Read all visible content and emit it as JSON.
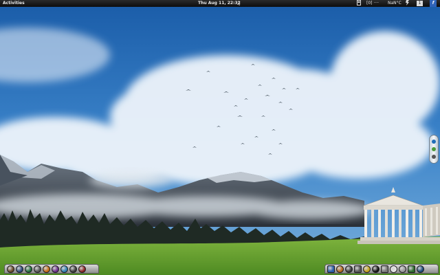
{
  "top_panel": {
    "activities_label": "Activities",
    "clock": "Thu Aug 11, 22:32",
    "music_icon": "♫",
    "network_text": "[0] ····",
    "weather_text": "NaN°C",
    "workspace_number": "1",
    "user_badge": "f"
  },
  "icons": {
    "music": "music-note-icon",
    "workspace_switcher": "workspace-switcher-icon",
    "network": "network-icon",
    "weather": "weather-icon",
    "power": "power-icon",
    "user": "user-icon"
  },
  "left_dock": {
    "items": [
      {
        "name": "app-launcher-1",
        "color": "#6b4a2a"
      },
      {
        "name": "app-launcher-2",
        "color": "#2e4a7a"
      },
      {
        "name": "app-launcher-3",
        "color": "#1f6d3a"
      },
      {
        "name": "app-launcher-4",
        "color": "#555555"
      },
      {
        "name": "app-launcher-5",
        "color": "#c46a14"
      },
      {
        "name": "app-launcher-6",
        "color": "#6a2c8a"
      },
      {
        "name": "app-launcher-7",
        "color": "#2c7fb3"
      },
      {
        "name": "app-launcher-8",
        "color": "#3c3c3c"
      },
      {
        "name": "app-launcher-9",
        "color": "#8a2222"
      }
    ]
  },
  "right_dock": {
    "items": [
      {
        "name": "app-launcher-a",
        "color": "#2b5ea8"
      },
      {
        "name": "app-launcher-b",
        "color": "#b7681b"
      },
      {
        "name": "app-launcher-c",
        "color": "#3a3a3a"
      },
      {
        "name": "app-launcher-d",
        "color": "#555555"
      },
      {
        "name": "app-launcher-e",
        "color": "#c4a21a"
      },
      {
        "name": "app-launcher-f",
        "color": "#111111"
      },
      {
        "name": "app-launcher-g",
        "color": "#777777"
      },
      {
        "name": "app-launcher-h",
        "color": "#e6e6e6"
      },
      {
        "name": "app-launcher-i",
        "color": "#999999"
      },
      {
        "name": "app-launcher-j",
        "color": "#2d6b2d"
      },
      {
        "name": "app-launcher-k",
        "color": "#1c4a7a"
      }
    ]
  },
  "colors": {
    "sky_top": "#1e62ad",
    "sky_bottom": "#6ea8d8",
    "grass": "#5e9a2e",
    "panel": "#141414"
  }
}
